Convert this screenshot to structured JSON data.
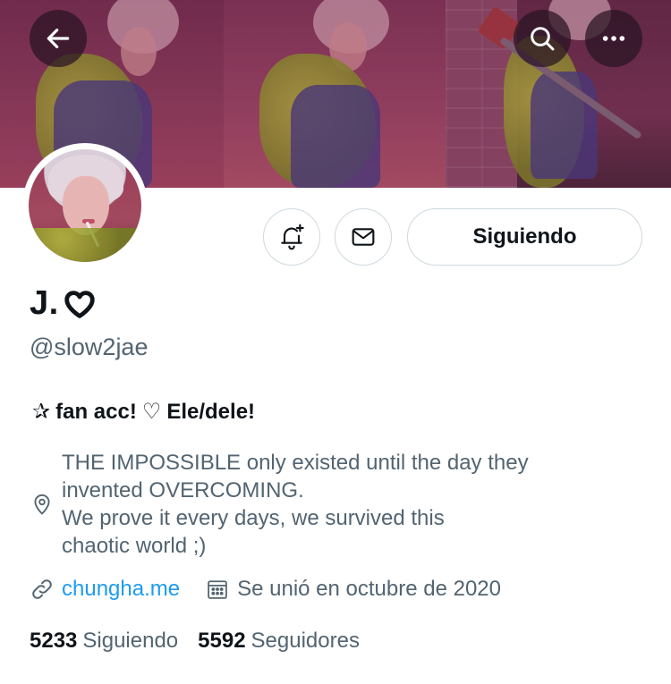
{
  "header": {
    "back_icon": "arrow-left-icon",
    "search_icon": "search-icon",
    "more_icon": "more-horizontal-icon"
  },
  "actions": {
    "bell_icon": "bell-plus-icon",
    "mail_icon": "mail-icon",
    "follow_label": "Siguiendo"
  },
  "profile": {
    "display_name": "J.",
    "display_name_icon": "heart-outline-icon",
    "handle": "@slow2jae",
    "bio": {
      "star": "✰",
      "text1": "fan acc!",
      "heart": "♡",
      "text2": "Ele/dele!"
    },
    "location_icon": "location-pin-icon",
    "location": "THE IMPOSSIBLE only existed until the day they\ninvented OVERCOMING.\nWe prove it every days, we survived this\nchaotic world ;)",
    "link_icon": "link-icon",
    "link": "chungha.me",
    "calendar_icon": "calendar-icon",
    "joined": "Se unió en octubre de 2020"
  },
  "stats": {
    "following_count": "5233",
    "following_label": "Siguiendo",
    "followers_count": "5592",
    "followers_label": "Seguidores"
  },
  "colors": {
    "link": "#1d9bf0",
    "secondary_text": "#536471",
    "primary_text": "#0f1419",
    "border": "#cfd9de"
  }
}
